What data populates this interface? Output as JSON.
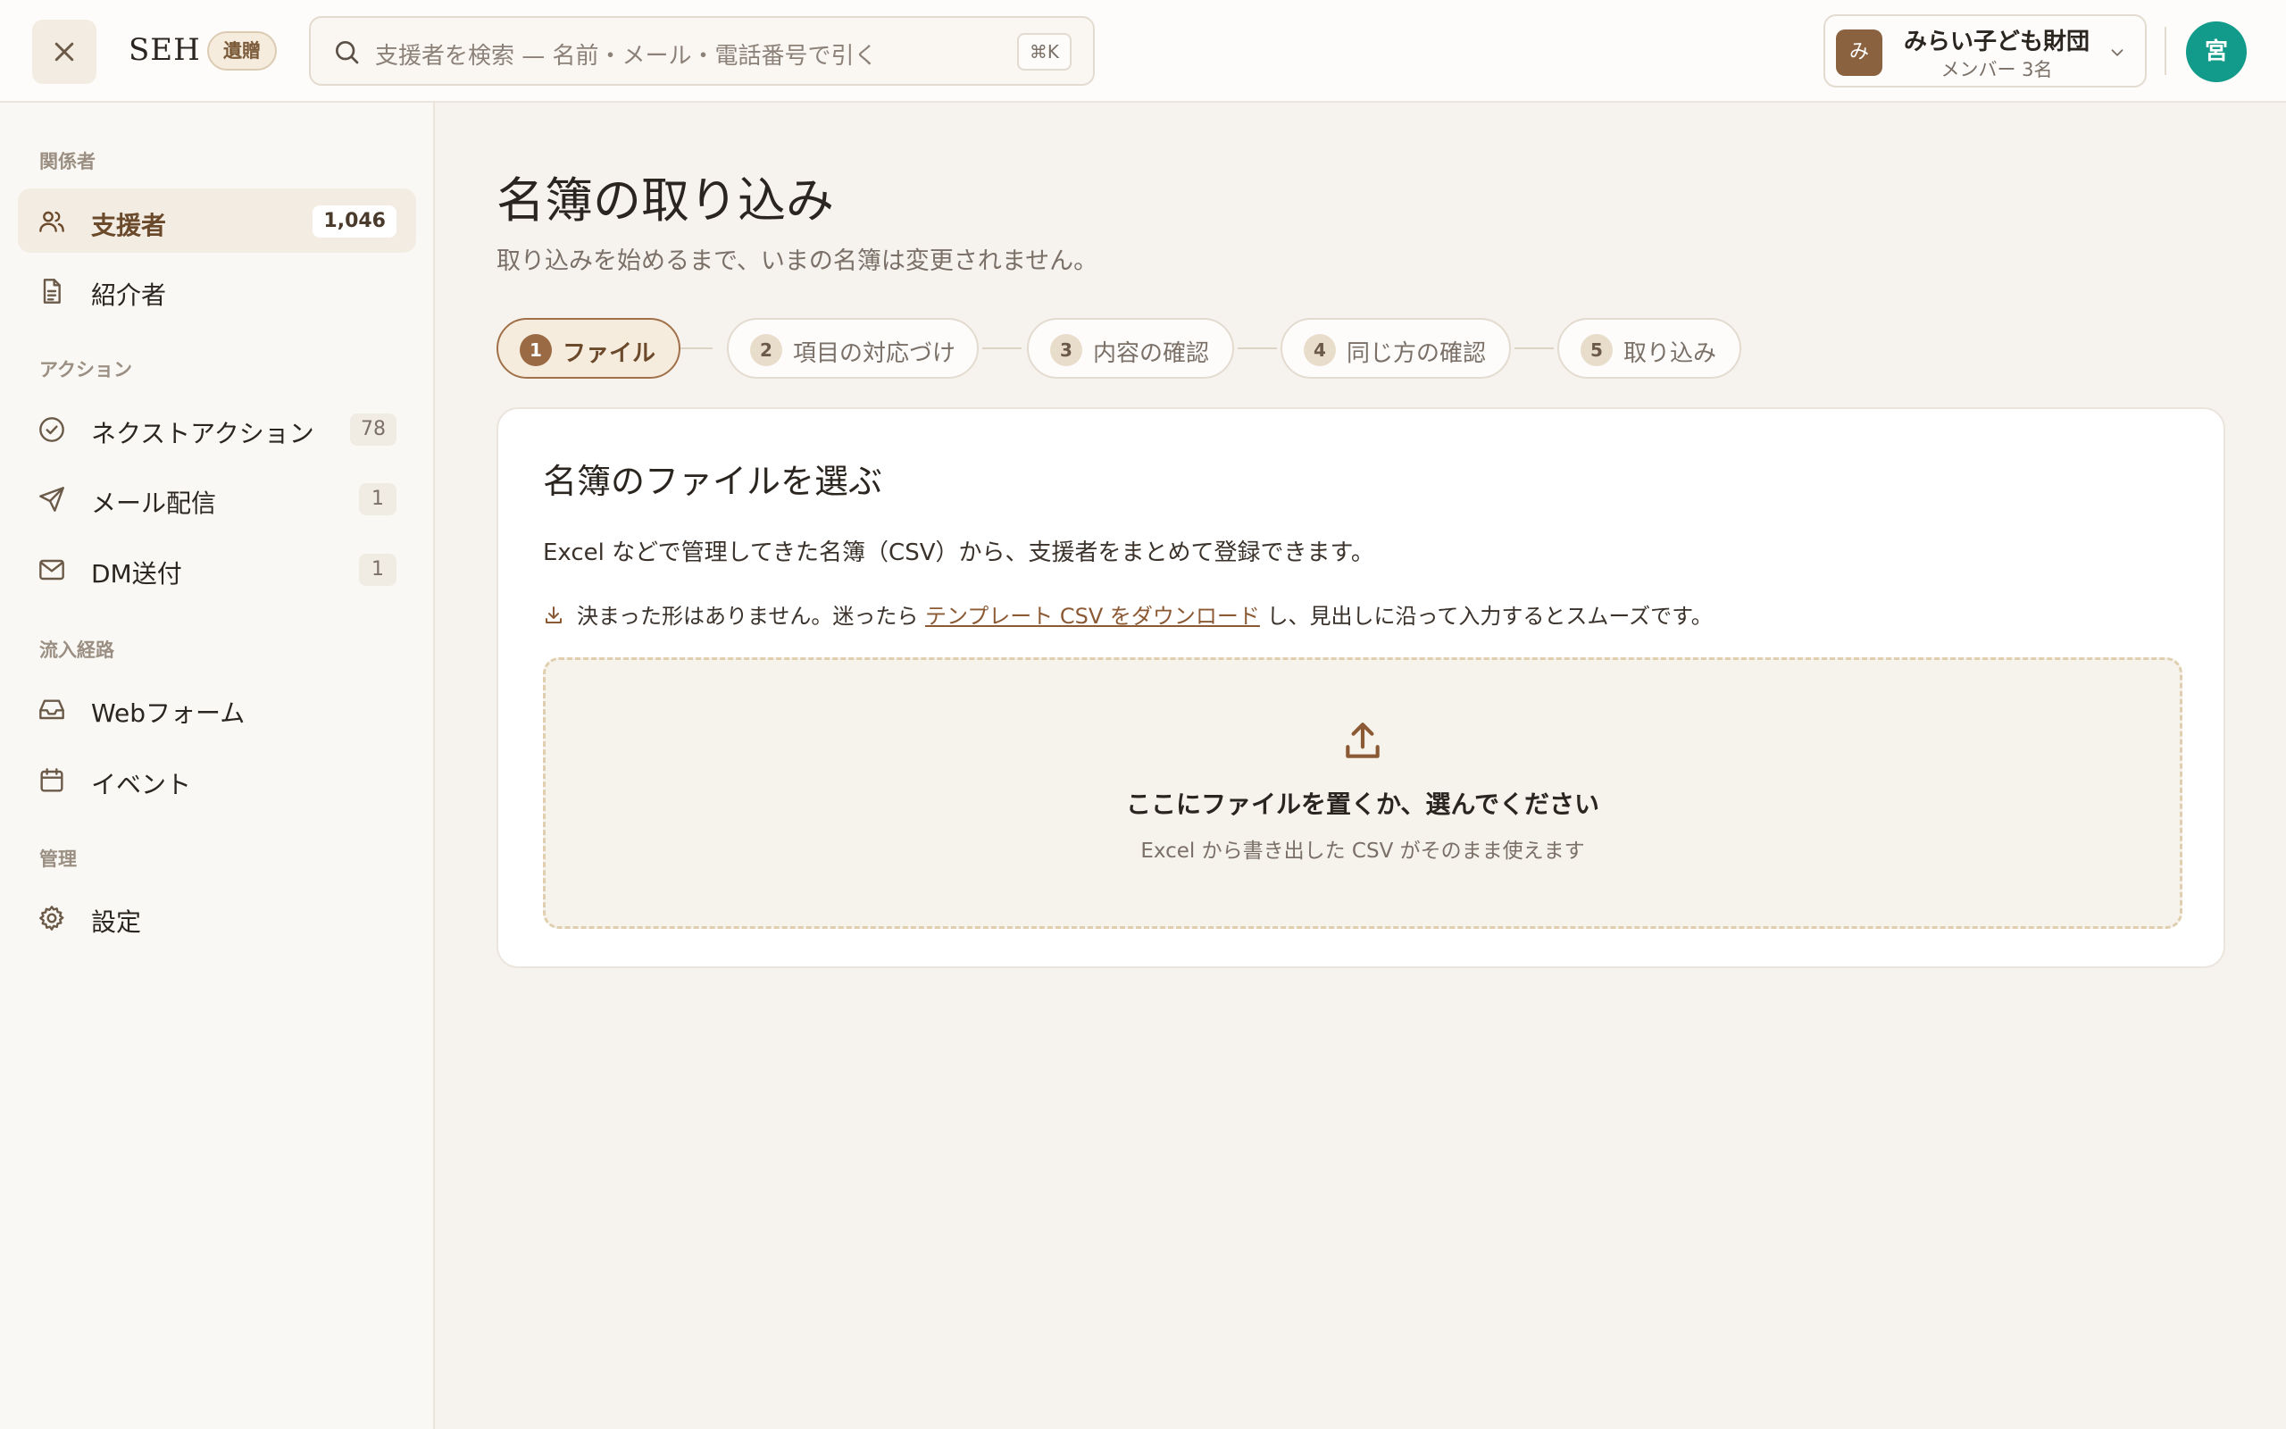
{
  "header": {
    "brand": "SEH",
    "brand_badge": "遺贈",
    "search_placeholder": "支援者を検索 — 名前・メール・電話番号で引く",
    "search_shortcut": "⌘K",
    "org": {
      "avatar": "み",
      "name": "みらい子ども財団",
      "members": "メンバー 3名"
    },
    "user_avatar": "宮"
  },
  "sidebar": {
    "sections": [
      {
        "label": "関係者"
      },
      {
        "label": "アクション"
      },
      {
        "label": "流入経路"
      },
      {
        "label": "管理"
      }
    ],
    "items": [
      {
        "label": "支援者",
        "count": "1,046",
        "icon": "users-icon",
        "active": true
      },
      {
        "label": "紹介者",
        "icon": "document-icon"
      },
      {
        "label": "ネクストアクション",
        "count": "78",
        "icon": "check-circle-icon"
      },
      {
        "label": "メール配信",
        "count": "1",
        "icon": "send-icon"
      },
      {
        "label": "DM送付",
        "count": "1",
        "icon": "mail-icon"
      },
      {
        "label": "Webフォーム",
        "icon": "inbox-icon"
      },
      {
        "label": "イベント",
        "icon": "calendar-icon"
      },
      {
        "label": "設定",
        "icon": "gear-icon"
      }
    ]
  },
  "main": {
    "title": "名簿の取り込み",
    "subtitle": "取り込みを始めるまで、いまの名簿は変更されません。",
    "steps": [
      {
        "num": "1",
        "label": "ファイル",
        "active": true
      },
      {
        "num": "2",
        "label": "項目の対応づけ"
      },
      {
        "num": "3",
        "label": "内容の確認"
      },
      {
        "num": "4",
        "label": "同じ方の確認"
      },
      {
        "num": "5",
        "label": "取り込み"
      }
    ],
    "card": {
      "title": "名簿のファイルを選ぶ",
      "description": "Excel などで管理してきた名簿（CSV）から、支援者をまとめて登録できます。",
      "hint_before": "決まった形はありません。迷ったら",
      "hint_link": "テンプレート CSV をダウンロード",
      "hint_after": "し、見出しに沿って入力するとスムーズです。",
      "dropzone_title": "ここにファイルを置くか、選んでください",
      "dropzone_subtitle": "Excel から書き出した CSV がそのまま使えます"
    }
  },
  "colors": {
    "accent": "#9a6a44",
    "background": "#f6f3ee",
    "user_avatar": "#129a8a"
  }
}
